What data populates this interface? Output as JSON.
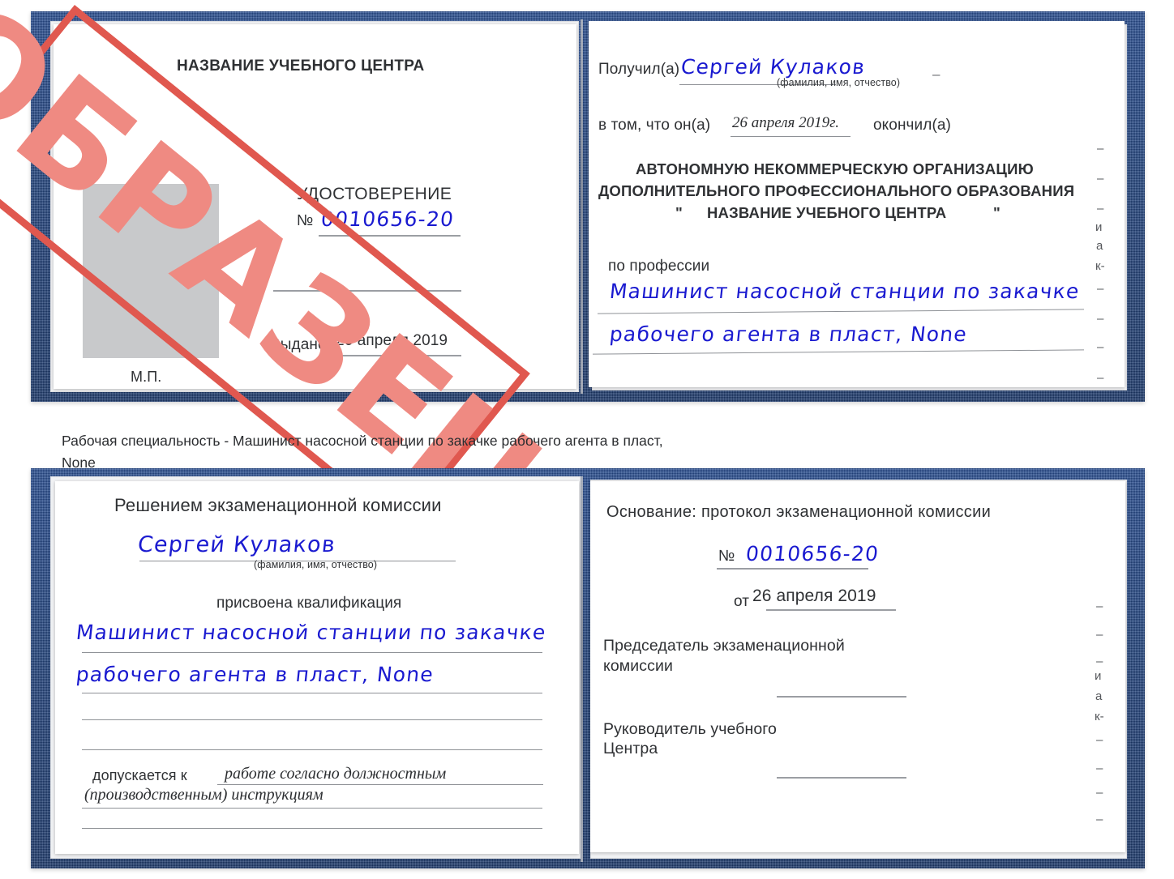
{
  "caption": "Рабочая специальность - Машинист насосной станции по закачке рабочего агента в пласт,\nNone",
  "stamp": {
    "label": "ОБРАЗЕЦ",
    "color": "#e0584f",
    "text_color": "#ef8a82"
  },
  "colors": {
    "cover_blue": "#23457f",
    "ink_blue": "#1a1ad0",
    "stamp_red": "#e0584f",
    "text_dark": "#2f3134"
  },
  "certificate_top": {
    "left_page": {
      "center_name": "НАЗВАНИЕ УЧЕБНОГО ЦЕНТРА",
      "doc_type": "УДОСТОВЕРЕНИЕ",
      "number_label": "№",
      "number_value": "0010656-20",
      "issued_label": "Выдано",
      "issued_date": "26 апреля 2019",
      "seal_label": "М.П."
    },
    "right_page": {
      "received_label": "Получил(а)",
      "received_name": "Сергей Кулаков",
      "fio_hint": "(фамилия, имя, отчество)",
      "in_that_label": "в том, что он(а)",
      "completion_date": "26 апреля 2019г.",
      "finished_label": "окончил(а)",
      "org_line1": "АВТОНОМНУЮ НЕКОММЕРЧЕСКУЮ ОРГАНИЗАЦИЮ",
      "org_line2": "ДОПОЛНИТЕЛЬНОГО ПРОФЕССИОНАЛЬНОГО ОБРАЗОВАНИЯ",
      "org_quote_open": "\"",
      "org_line3": "НАЗВАНИЕ УЧЕБНОГО ЦЕНТРА",
      "org_quote_close": "\"",
      "profession_label": "по профессии",
      "profession_line1": "Машинист насосной станции по закачке",
      "profession_line2": "рабочего агента в пласт, None"
    },
    "edge_fragments": [
      "–",
      "–",
      "–",
      "и",
      "а",
      "к-",
      "–",
      "–",
      "–",
      "–"
    ]
  },
  "certificate_bottom": {
    "left_page": {
      "heading": "Решением экзаменационной комиссии",
      "name": "Сергей Кулаков",
      "fio_hint": "(фамилия, имя, отчество)",
      "qualification_label": "присвоена квалификация",
      "qualification_line1": "Машинист насосной станции по закачке",
      "qualification_line2": "рабочего агента в пласт, None",
      "admitted_label": "допускается к",
      "admitted_line1": "работе согласно должностным",
      "admitted_line2": "(производственным) инструкциям"
    },
    "right_page": {
      "basis_label": "Основание: протокол экзаменационной комиссии",
      "number_label": "№",
      "number_value": "0010656-20",
      "date_label": "от",
      "date_value": "26 апреля 2019",
      "chair_line1": "Председатель экзаменационной",
      "chair_line2": "комиссии",
      "head_line1": "Руководитель учебного",
      "head_line2": "Центра"
    },
    "edge_fragments": [
      "–",
      "–",
      "–",
      "и",
      "а",
      "к-",
      "–",
      "–",
      "–",
      "–"
    ]
  }
}
